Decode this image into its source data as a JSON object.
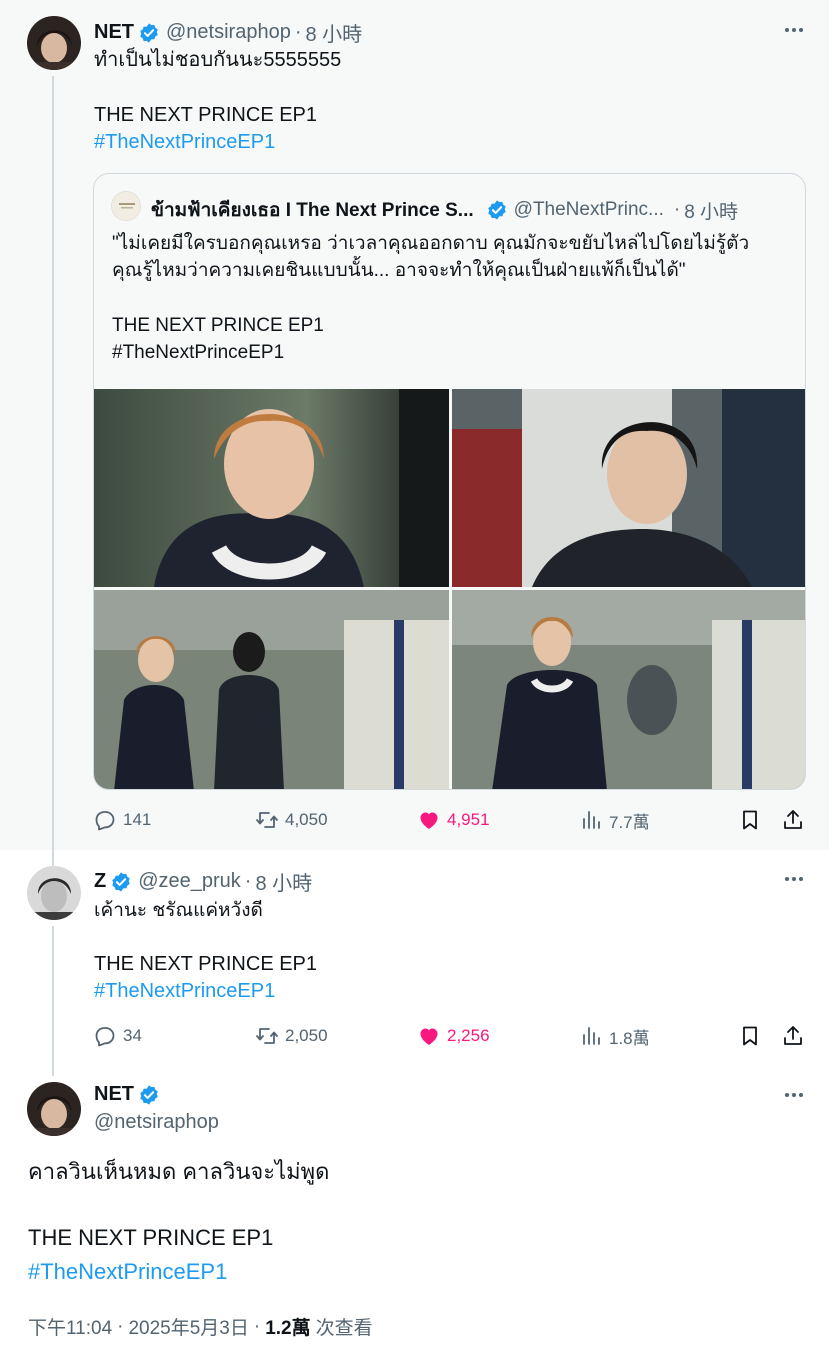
{
  "colors": {
    "accent": "#1d9bf0",
    "like": "#f91880",
    "muted": "#536471",
    "verified": "#1d9bf0"
  },
  "tweet1": {
    "avatar_icon": "user-avatar-photo",
    "name": "NET",
    "handle": "@netsiraphop",
    "dot": "·",
    "time": "8 小時",
    "text_line1": "ทำเป็นไม่ชอบกันนะ5555555",
    "text_line2": "THE NEXT PRINCE EP1",
    "hashtag": "#TheNextPrinceEP1",
    "quote": {
      "name": "ข้ามฟ้าเคียงเธอ I The Next Prince S...",
      "handle": "@TheNextPrinc...",
      "dot": "·",
      "time": "8 小時",
      "line1": "\"ไม่เคยมีใครบอกคุณเหรอ ว่าเวลาคุณออกดาบ คุณมักจะขยับไหล่ไปโดยไม่รู้ตัว",
      "line2": "คุณรู้ไหมว่าความเคยชินแบบนั้น... อาจจะทำให้คุณเป็นฝ่ายแพ้ก็เป็นได้\"",
      "line3": "THE NEXT PRINCE EP1",
      "line4": "#TheNextPrinceEP1"
    },
    "stats": {
      "replies": "141",
      "retweets": "4,050",
      "likes": "4,951",
      "views": "7.7萬"
    }
  },
  "tweet2": {
    "avatar_icon": "user-avatar-photo",
    "name": "Z",
    "handle": "@zee_pruk",
    "dot": "·",
    "time": "8 小時",
    "text_line1": "เค้านะ ชรัณแค่หวังดี",
    "text_line2": "THE NEXT PRINCE EP1",
    "hashtag": "#TheNextPrinceEP1",
    "stats": {
      "replies": "34",
      "retweets": "2,050",
      "likes": "2,256",
      "views": "1.8萬"
    }
  },
  "tweet3": {
    "avatar_icon": "user-avatar-photo",
    "name": "NET",
    "handle": "@netsiraphop",
    "text_line1": "คาลวินเห็นหมด คาลวินจะไม่พูด",
    "text_line2": "THE NEXT PRINCE EP1",
    "hashtag": "#TheNextPrinceEP1",
    "meta_time": "下午11:04",
    "meta_dot": "·",
    "meta_date": "2025年5月3日",
    "meta_dot2": "·",
    "meta_views_num": "1.2萬",
    "meta_views_label": "次查看"
  }
}
